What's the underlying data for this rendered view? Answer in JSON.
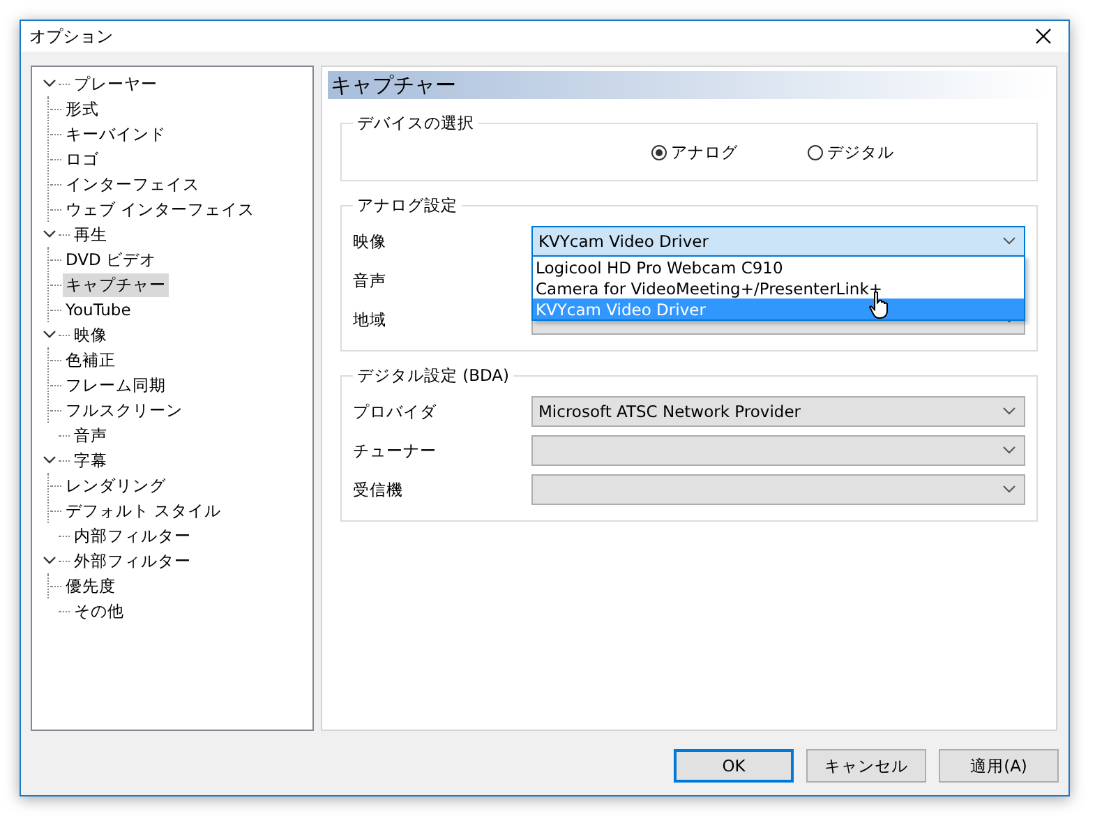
{
  "window": {
    "title": "オプション"
  },
  "tree": [
    {
      "label": "プレーヤー",
      "expanded": true,
      "selected": false,
      "children": [
        {
          "label": "形式",
          "selected": false
        },
        {
          "label": "キーバインド",
          "selected": false
        },
        {
          "label": "ロゴ",
          "selected": false
        },
        {
          "label": "インターフェイス",
          "selected": false
        },
        {
          "label": "ウェブ インターフェイス",
          "selected": false
        }
      ]
    },
    {
      "label": "再生",
      "expanded": true,
      "selected": false,
      "children": [
        {
          "label": "DVD ビデオ",
          "selected": false
        },
        {
          "label": "キャプチャー",
          "selected": true
        },
        {
          "label": "YouTube",
          "selected": false
        }
      ]
    },
    {
      "label": "映像",
      "expanded": true,
      "selected": false,
      "children": [
        {
          "label": "色補正",
          "selected": false
        },
        {
          "label": "フレーム同期",
          "selected": false
        },
        {
          "label": "フルスクリーン",
          "selected": false
        }
      ]
    },
    {
      "label": "音声",
      "selected": false
    },
    {
      "label": "字幕",
      "expanded": true,
      "selected": false,
      "children": [
        {
          "label": "レンダリング",
          "selected": false
        },
        {
          "label": "デフォルト スタイル",
          "selected": false
        }
      ]
    },
    {
      "label": "内部フィルター",
      "selected": false
    },
    {
      "label": "外部フィルター",
      "expanded": true,
      "selected": false,
      "children": [
        {
          "label": "優先度",
          "selected": false
        }
      ]
    },
    {
      "label": "その他",
      "selected": false
    }
  ],
  "panel": {
    "title": "キャプチャー",
    "device_group": {
      "title": "デバイスの選択",
      "options": [
        {
          "label": "アナログ",
          "selected": true
        },
        {
          "label": "デジタル",
          "selected": false
        }
      ]
    },
    "analog_group": {
      "title": "アナログ設定",
      "rows": [
        {
          "label": "映像",
          "value": "KVYcam Video Driver",
          "open": true,
          "options": [
            {
              "label": "Logicool HD Pro Webcam C910",
              "selected": false
            },
            {
              "label": "Camera for VideoMeeting+/PresenterLink+",
              "selected": false
            },
            {
              "label": "KVYcam Video Driver",
              "selected": true
            }
          ]
        },
        {
          "label": "音声"
        },
        {
          "label": "地域",
          "open": false
        }
      ]
    },
    "digital_group": {
      "title": "デジタル設定 (BDA)",
      "rows": [
        {
          "label": "プロバイダ",
          "value": "Microsoft ATSC Network Provider",
          "open": false
        },
        {
          "label": "チューナー",
          "open": false
        },
        {
          "label": "受信機",
          "open": false
        }
      ]
    }
  },
  "buttons": [
    {
      "label": "OK",
      "default": true
    },
    {
      "label": "キャンセル",
      "default": false
    },
    {
      "label": "適用(A)",
      "default": false
    }
  ]
}
